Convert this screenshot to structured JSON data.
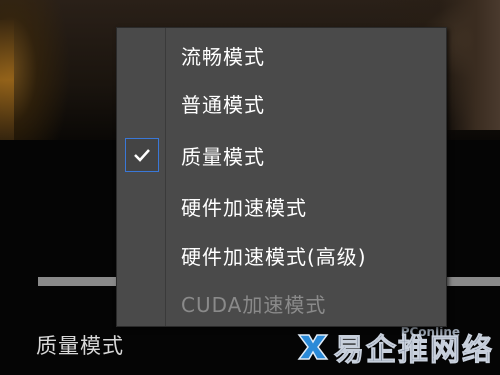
{
  "player": {
    "current_mode_label": "质量模式",
    "progress_fraction": 1.0
  },
  "menu": {
    "items": [
      {
        "label": "流畅模式",
        "checked": false,
        "disabled": false
      },
      {
        "label": "普通模式",
        "checked": false,
        "disabled": false
      },
      {
        "label": "质量模式",
        "checked": true,
        "disabled": false
      },
      {
        "label": "硬件加速模式",
        "checked": false,
        "disabled": false
      },
      {
        "label": "硬件加速模式(高级)",
        "checked": false,
        "disabled": false
      },
      {
        "label": "CUDA加速模式",
        "checked": false,
        "disabled": true
      }
    ]
  },
  "watermark": {
    "text": "易企推网络",
    "brand": "PConline"
  },
  "icons": {
    "check": "check-icon",
    "watermark_logo": "cross-logo-icon"
  },
  "colors": {
    "menu_bg": "#4a4a4a",
    "check_border": "#3a78d8",
    "menu_text": "#ffffff",
    "disabled_text": "#8a8a8a"
  }
}
